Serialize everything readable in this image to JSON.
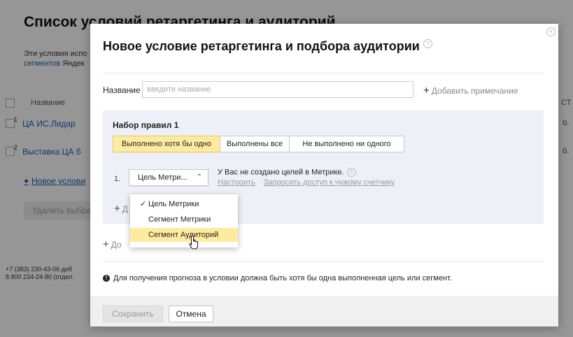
{
  "background": {
    "title": "Список условий ретаргетинга и аудиторий",
    "description_start": "Эти условия испо",
    "description_link": "сегментов",
    "description_end": " Яндек",
    "table": {
      "column_name": "Название",
      "column_right": "СТ",
      "rows": [
        {
          "num": "1",
          "name": "ЦА ИС.Лидар",
          "value": "0."
        },
        {
          "num": "2",
          "name": "Выставка ЦА б",
          "value": "0."
        }
      ]
    },
    "add_condition_link": "Новое услови",
    "delete_button": "Удалить выбра",
    "phones": [
      "+7 (383) 230-43-06 доб",
      "8 800 234-24-80 (отдел"
    ]
  },
  "modal": {
    "title": "Новое условие ретаргетинга и подбора аудитории",
    "help_glyph": "?",
    "close_glyph": "×",
    "name": {
      "label": "Название",
      "value": "",
      "placeholder": "введите название"
    },
    "add_note": "Добавить примечание",
    "plus_glyph": "+",
    "ruleset": {
      "title": "Набор правил 1",
      "modes": [
        {
          "label": "Выполнено хотя бы одно",
          "active": true
        },
        {
          "label": "Выполнены все",
          "active": false
        },
        {
          "label": "Не выполнено ни одного",
          "active": false
        }
      ],
      "rule_number": "1.",
      "selected_type": "Цель Метри...",
      "chevron": "⌃",
      "message": "У Вас не создано целей в Метрике.",
      "links": [
        "Настроить",
        "Запросить доступ к чужому счетчику"
      ],
      "add_rule": "Д"
    },
    "add_ruleset": "До",
    "dropdown": {
      "options": [
        {
          "label": "Цель Метрики",
          "checked": true,
          "hover": false
        },
        {
          "label": "Сегмент Метрики",
          "checked": false,
          "hover": false
        },
        {
          "label": "Сегмент Аудиторий",
          "checked": false,
          "hover": true
        }
      ],
      "check_glyph": "✓"
    },
    "info": "Для получения прогноза в условии должна быть хотя бы одна выполненная цель или сегмент.",
    "info_glyph": "!",
    "buttons": {
      "save": "Сохранить",
      "cancel": "Отмена"
    }
  },
  "colors": {
    "active_segment": "#ffeba0",
    "ruleset_background": "#eef0f7",
    "link": "#1a5fb4"
  }
}
